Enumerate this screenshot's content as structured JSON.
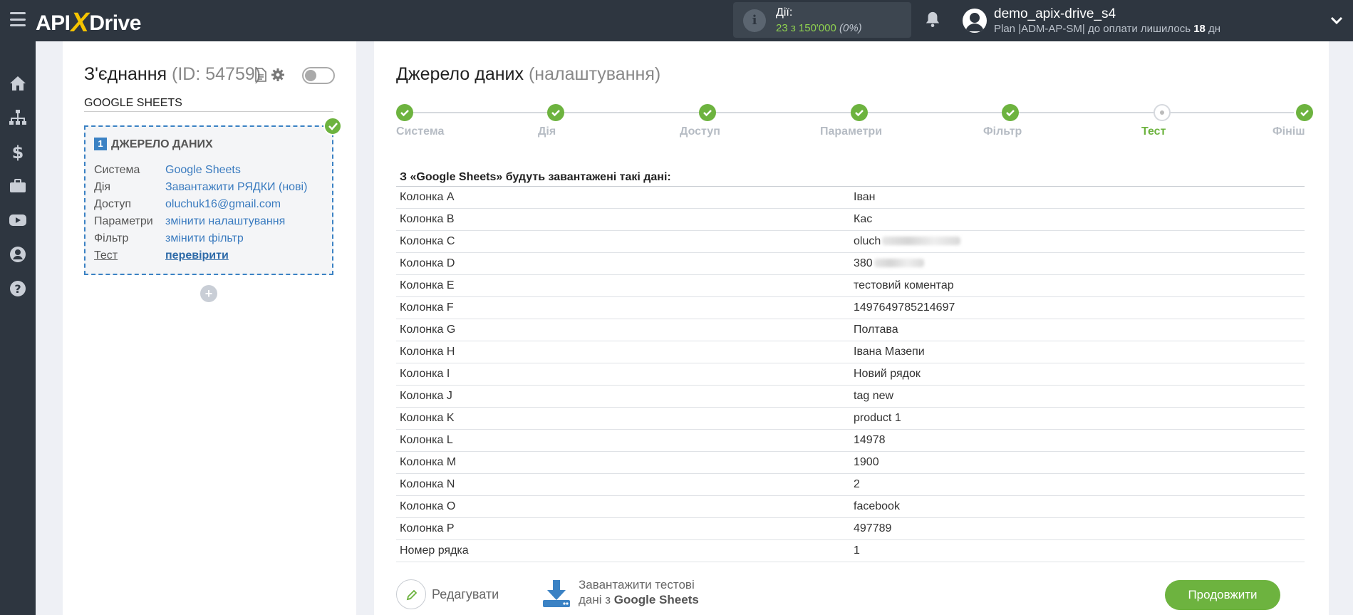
{
  "header": {
    "logo_left": "API",
    "logo_x": "X",
    "logo_right": "Drive",
    "actions_label": "Дії:",
    "actions_count": "23 з 150'000",
    "actions_percent": "(0%)",
    "username": "demo_apix-drive_s4",
    "plan_prefix": "Plan |ADM-AP-SM| до оплати лишилось ",
    "plan_days": "18",
    "plan_suffix": " дн"
  },
  "sidebar": {
    "items": [
      "home-icon",
      "sitemap-icon",
      "dollar-icon",
      "briefcase-icon",
      "youtube-icon",
      "user-icon",
      "help-icon"
    ]
  },
  "connection": {
    "title": "З'єднання",
    "id_text": "(ID: 54759)",
    "name": "GOOGLE SHEETS",
    "source": {
      "number": "1",
      "header": "ДЖЕРЕЛО ДАНИХ",
      "rows": [
        {
          "key": "Система",
          "value": "Google Sheets"
        },
        {
          "key": "Дія",
          "value": "Завантажити РЯДКИ (нові)"
        },
        {
          "key": "Доступ",
          "value": "oluchuk16@gmail.com"
        },
        {
          "key": "Параметри",
          "value": "змінити налаштування"
        },
        {
          "key": "Фільтр",
          "value": "змінити фільтр"
        },
        {
          "key": "Тест",
          "value": "перевірити"
        }
      ]
    },
    "add_symbol": "+"
  },
  "main": {
    "title": "Джерело даних",
    "subtitle": "(налаштування)",
    "steps": [
      {
        "label": "Система",
        "state": "done"
      },
      {
        "label": "Дія",
        "state": "done"
      },
      {
        "label": "Доступ",
        "state": "done"
      },
      {
        "label": "Параметри",
        "state": "done"
      },
      {
        "label": "Фільтр",
        "state": "done"
      },
      {
        "label": "Тест",
        "state": "current"
      },
      {
        "label": "Фініш",
        "state": "done"
      }
    ],
    "table_header": "З «Google Sheets» будуть завантажені такі дані:",
    "rows": [
      {
        "name": "Колонка A",
        "value": "Іван"
      },
      {
        "name": "Колонка B",
        "value": "Кас"
      },
      {
        "name": "Колонка C",
        "value": "oluch"
      },
      {
        "name": "Колонка D",
        "value": "380"
      },
      {
        "name": "Колонка E",
        "value": "тестовий коментар"
      },
      {
        "name": "Колонка F",
        "value": "1497649785214697"
      },
      {
        "name": "Колонка G",
        "value": "Полтава"
      },
      {
        "name": "Колонка H",
        "value": "Івана Мазепи"
      },
      {
        "name": "Колонка I",
        "value": "Новий рядок"
      },
      {
        "name": "Колонка J",
        "value": "tag new"
      },
      {
        "name": "Колонка K",
        "value": "product 1"
      },
      {
        "name": "Колонка L",
        "value": "14978"
      },
      {
        "name": "Колонка M",
        "value": "1900"
      },
      {
        "name": "Колонка N",
        "value": "2"
      },
      {
        "name": "Колонка O",
        "value": "facebook"
      },
      {
        "name": "Колонка P",
        "value": "497789"
      },
      {
        "name": "Номер рядка",
        "value": "1"
      }
    ],
    "edit_label": "Редагувати",
    "load_line1": "Завантажити тестові",
    "load_line2_prefix": "дані з ",
    "load_line2_bold": "Google Sheets",
    "continue_label": "Продовжити"
  },
  "colors": {
    "topbar": "#2e3640",
    "accent_green": "#6db33f",
    "link_blue": "#3a7bbf",
    "logo_x": "#f5c400"
  }
}
